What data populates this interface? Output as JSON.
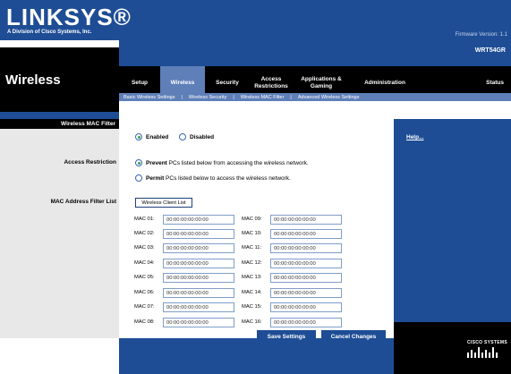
{
  "brand": {
    "logo": "LINKSYS®",
    "sub": "A Division of Cisco Systems, Inc."
  },
  "firmware": "Firmware Version: 1.1",
  "model": "WRT54GR",
  "page_title": "Wireless",
  "tabs": [
    {
      "label": "Setup"
    },
    {
      "label": "Wireless",
      "active": true
    },
    {
      "label": "Security"
    },
    {
      "label": "Access Restrictions"
    },
    {
      "label": "Applications & Gaming"
    },
    {
      "label": "Administration"
    },
    {
      "label": "Status"
    }
  ],
  "subnav": {
    "items": [
      "Basic Wireless Settings",
      "Wireless Security",
      "Wireless MAC Filter",
      "Advanced Wireless Settings"
    ],
    "separator": "|"
  },
  "section_header": "Wireless MAC Filter",
  "filter": {
    "enabled_label": "Enabled",
    "disabled_label": "Disabled",
    "selected": "enabled"
  },
  "access_restriction": {
    "label": "Access Restriction",
    "prevent_bold": "Prevent",
    "prevent_rest": "PCs listed below from accessing the wireless network.",
    "permit_bold": "Permit",
    "permit_rest": "PCs listed below to access the wireless network.",
    "selected": "prevent"
  },
  "mac_list": {
    "label": "MAC Address Filter List",
    "client_list_button": "Wireless Client List",
    "entries": [
      {
        "label": "MAC 01:",
        "value": "00:00:00:00:00:00"
      },
      {
        "label": "MAC 02:",
        "value": "00:00:00:00:00:00"
      },
      {
        "label": "MAC 03:",
        "value": "00:00:00:00:00:00"
      },
      {
        "label": "MAC 04:",
        "value": "00:00:00:00:00:00"
      },
      {
        "label": "MAC 05:",
        "value": "00:00:00:00:00:00"
      },
      {
        "label": "MAC 06:",
        "value": "00:00:00:00:00:00"
      },
      {
        "label": "MAC 07:",
        "value": "00:00:00:00:00:00"
      },
      {
        "label": "MAC 08:",
        "value": "00:00:00:00:00:00"
      },
      {
        "label": "MAC 09:",
        "value": "00:00:00:00:00:00"
      },
      {
        "label": "MAC 10:",
        "value": "00:00:00:00:00:00"
      },
      {
        "label": "MAC 11:",
        "value": "00:00:00:00:00:00"
      },
      {
        "label": "MAC 12:",
        "value": "00:00:00:00:00:00"
      },
      {
        "label": "MAC 13:",
        "value": "00:00:00:00:00:00"
      },
      {
        "label": "MAC 14:",
        "value": "00:00:00:00:00:00"
      },
      {
        "label": "MAC 15:",
        "value": "00:00:00:00:00:00"
      },
      {
        "label": "MAC 16:",
        "value": "00:00:00:00:00:00"
      }
    ]
  },
  "help": {
    "link": "Help..."
  },
  "actions": {
    "save": "Save Settings",
    "cancel": "Cancel Changes"
  },
  "cisco": {
    "text": "CISCO SYSTEMS",
    "icon": "cisco-bridge-icon"
  },
  "colors": {
    "brand_blue": "#1e4d95",
    "tab_active": "#5e7fb8",
    "radio_dot": "#2ca14a"
  }
}
